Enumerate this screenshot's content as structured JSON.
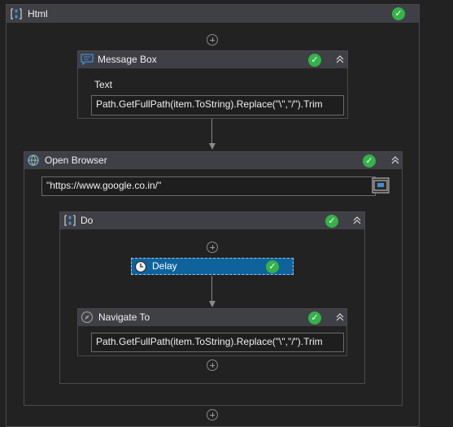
{
  "root": {
    "title": "Html",
    "icon": "sequence-icon"
  },
  "message_box": {
    "title": "Message Box",
    "icon": "message-box-icon",
    "text_label": "Text",
    "text_value": "Path.GetFullPath(item.ToString).Replace(\"\\\",\"/\").Trim"
  },
  "open_browser": {
    "title": "Open Browser",
    "icon": "browser-icon",
    "url_value": "\"https://www.google.co.in/\""
  },
  "do_sequence": {
    "title": "Do",
    "icon": "sequence-icon"
  },
  "delay": {
    "title": "Delay",
    "icon": "clock-icon"
  },
  "navigate_to": {
    "title": "Navigate To",
    "icon": "compass-icon",
    "url_value": "Path.GetFullPath(item.ToString).Replace(\"\\\",\"/\").Trim"
  },
  "colors": {
    "background": "#222222",
    "header": "#3f3f46",
    "selected": "#0e639c",
    "check": "#35b24a",
    "icon_blue": "#3c8fd6"
  }
}
